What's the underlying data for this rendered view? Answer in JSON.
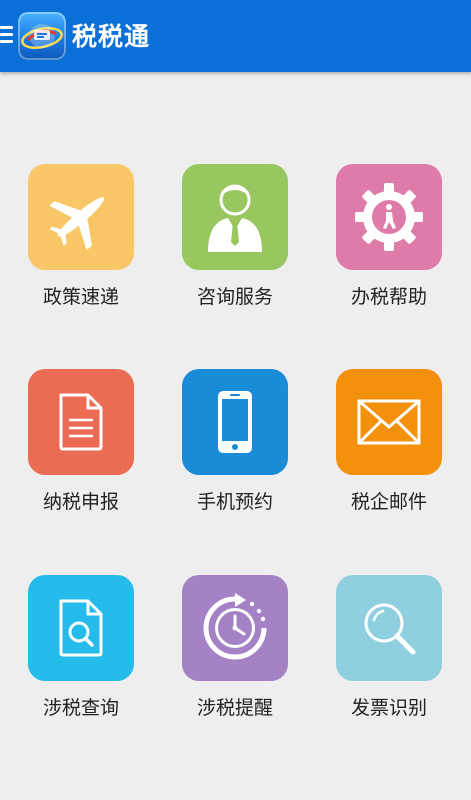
{
  "app": {
    "title": "税税通"
  },
  "tiles": [
    {
      "label": "政策速递",
      "icon": "airplane-icon",
      "color": "#f9c768"
    },
    {
      "label": "咨询服务",
      "icon": "consultant-icon",
      "color": "#98c760"
    },
    {
      "label": "办税帮助",
      "icon": "gear-help-icon",
      "color": "#df7ba9"
    },
    {
      "label": "纳税申报",
      "icon": "document-icon",
      "color": "#ec6b53"
    },
    {
      "label": "手机预约",
      "icon": "phone-icon",
      "color": "#1a8bd6"
    },
    {
      "label": "税企邮件",
      "icon": "mail-icon",
      "color": "#f3910c"
    },
    {
      "label": "涉税查询",
      "icon": "search-document-icon",
      "color": "#25bbeb"
    },
    {
      "label": "涉税提醒",
      "icon": "clock-icon",
      "color": "#a582c6"
    },
    {
      "label": "发票识别",
      "icon": "magnifier-icon",
      "color": "#8fcfe0"
    }
  ]
}
